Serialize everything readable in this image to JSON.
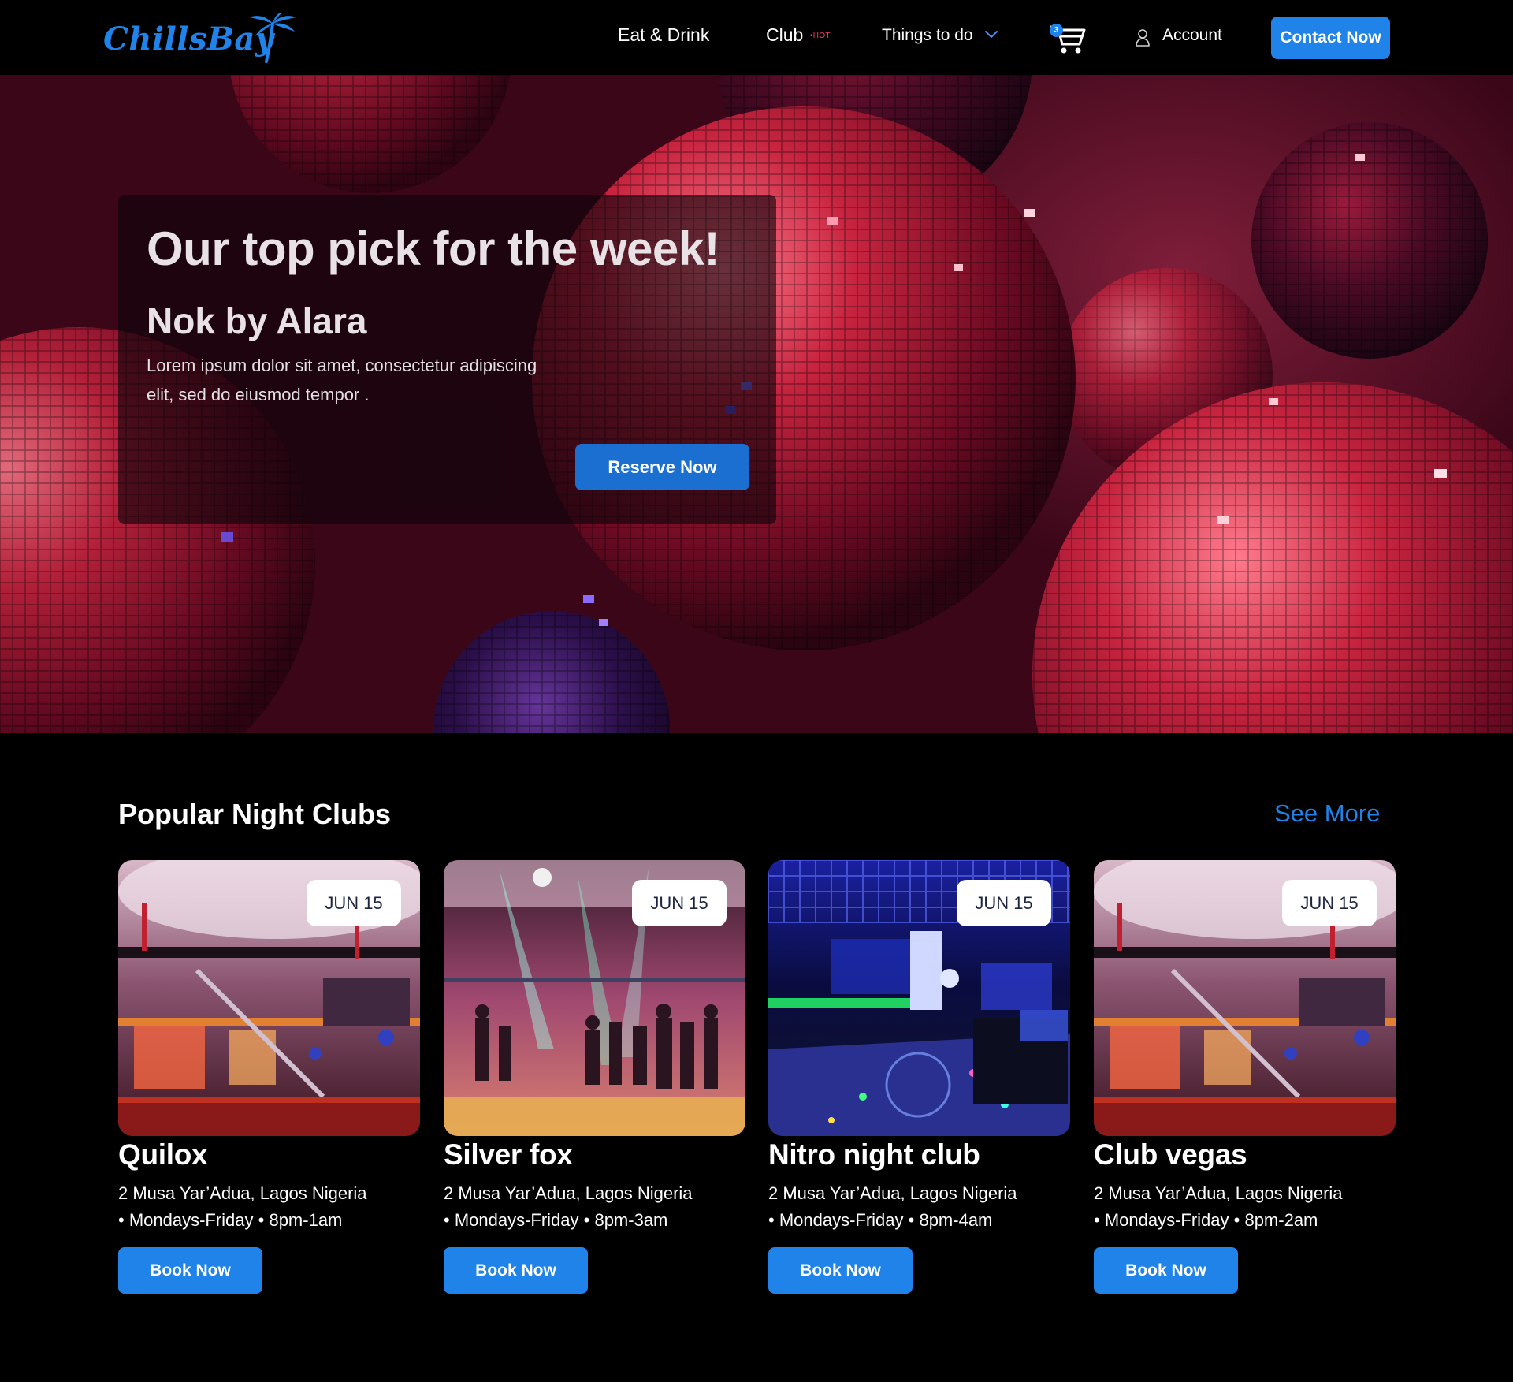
{
  "brand": {
    "logo_text": "ChillsBay",
    "accent": "#1f83ea"
  },
  "nav": {
    "items": [
      {
        "label": "Eat & Drink"
      },
      {
        "label": "Club",
        "badge": "•HOT"
      },
      {
        "label": "Things to do",
        "icon": "chevron-down-icon"
      }
    ],
    "cart": {
      "count": "3",
      "icon": "cart-icon"
    },
    "account": {
      "label": "Account",
      "icon": "user-icon"
    },
    "contact_label": "Contact Now"
  },
  "hero": {
    "heading": "Our top pick for the week!",
    "venue": "Nok by Alara",
    "description": "Lorem ipsum dolor sit amet, consectetur adipiscing elit, sed do eiusmod tempor .",
    "cta": "Reserve Now"
  },
  "clubs_section": {
    "title": "Popular Night Clubs",
    "see_more": "See More",
    "cards": [
      {
        "date": "JUN 15",
        "name": "Quilox",
        "address": "2 Musa Yar’Adua, Lagos Nigeria",
        "hours": "• Mondays-Friday • 8pm-1am",
        "cta": "Book Now"
      },
      {
        "date": "JUN 15",
        "name": "Silver fox",
        "address": "2 Musa Yar’Adua, Lagos Nigeria",
        "hours": "• Mondays-Friday • 8pm-3am",
        "cta": "Book Now"
      },
      {
        "date": "JUN 15",
        "name": "Nitro night club",
        "address": "2 Musa Yar’Adua, Lagos Nigeria",
        "hours": "• Mondays-Friday • 8pm-4am",
        "cta": "Book Now"
      },
      {
        "date": "JUN 15",
        "name": "Club vegas",
        "address": "2 Musa Yar’Adua, Lagos Nigeria",
        "hours": "• Mondays-Friday • 8pm-2am",
        "cta": "Book Now"
      }
    ]
  }
}
